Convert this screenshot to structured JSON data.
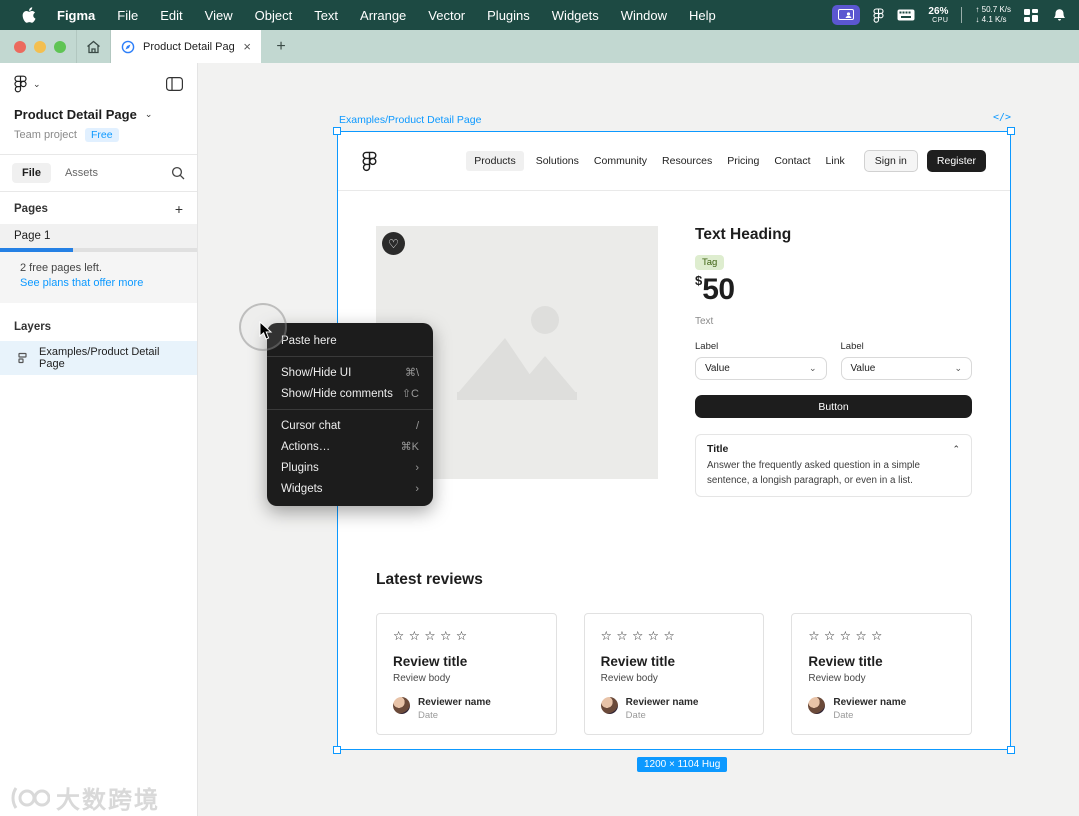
{
  "menubar": {
    "items": [
      "Figma",
      "File",
      "Edit",
      "View",
      "Object",
      "Text",
      "Arrange",
      "Vector",
      "Plugins",
      "Widgets",
      "Window",
      "Help"
    ],
    "status": {
      "cpu_percent": "26%",
      "cpu_label": "CPU",
      "net_up": "↑ 50.7 K/s",
      "net_down": "↓ 4.1 K/s"
    }
  },
  "tabbar": {
    "tab_title": "Product Detail Page",
    "close": "×",
    "new_tab": "+"
  },
  "sidebar": {
    "file_title": "Product Detail Page",
    "project_label": "Team project",
    "plan_badge": "Free",
    "tab_file": "File",
    "tab_assets": "Assets",
    "pages_label": "Pages",
    "add_page": "+",
    "page_item": "Page 1",
    "banner": {
      "line1": "2 free pages left.",
      "link": "See plans that offer more"
    },
    "layers_label": "Layers",
    "layer_item": "Examples/Product Detail Page",
    "chevron": "⌄"
  },
  "canvas": {
    "frame_label": "Examples/Product Detail Page",
    "dev_icon": "</>",
    "size_badge": "1200 × 1104 Hug",
    "nav": {
      "links": [
        "Products",
        "Solutions",
        "Community",
        "Resources",
        "Pricing",
        "Contact",
        "Link"
      ],
      "signin": "Sign in",
      "register": "Register"
    },
    "product": {
      "heading": "Text Heading",
      "tag": "Tag",
      "currency": "$",
      "price": "50",
      "text": "Text",
      "heart": "♡",
      "fields": [
        {
          "label": "Label",
          "value": "Value",
          "chevron": "⌄"
        },
        {
          "label": "Label",
          "value": "Value",
          "chevron": "⌄"
        }
      ],
      "button": "Button",
      "faq": {
        "title": "Title",
        "chevron": "⌃",
        "body": "Answer the frequently asked question in a simple sentence, a longish paragraph, or even in a list."
      }
    },
    "reviews": {
      "heading": "Latest reviews",
      "cards": [
        {
          "stars": "☆☆☆☆☆",
          "title": "Review title",
          "body": "Review body",
          "name": "Reviewer name",
          "date": "Date"
        },
        {
          "stars": "☆☆☆☆☆",
          "title": "Review title",
          "body": "Review body",
          "name": "Reviewer name",
          "date": "Date"
        },
        {
          "stars": "☆☆☆☆☆",
          "title": "Review title",
          "body": "Review body",
          "name": "Reviewer name",
          "date": "Date"
        }
      ]
    }
  },
  "context_menu": {
    "paste": {
      "label": "Paste here"
    },
    "ui": {
      "label": "Show/Hide UI",
      "shortcut": "⌘\\"
    },
    "comments": {
      "label": "Show/Hide comments",
      "shortcut": "⇧C"
    },
    "cursor_chat": {
      "label": "Cursor chat",
      "shortcut": "/"
    },
    "actions": {
      "label": "Actions…",
      "shortcut": "⌘K"
    },
    "plugins": {
      "label": "Plugins",
      "arrow": "›"
    },
    "widgets": {
      "label": "Widgets",
      "arrow": "›"
    }
  },
  "watermark": {
    "text": "大数跨境"
  },
  "colors": {
    "accent_blue": "#0D99FF",
    "menubar_green": "#1D4A43",
    "selection_blue": "#0D99FF"
  }
}
